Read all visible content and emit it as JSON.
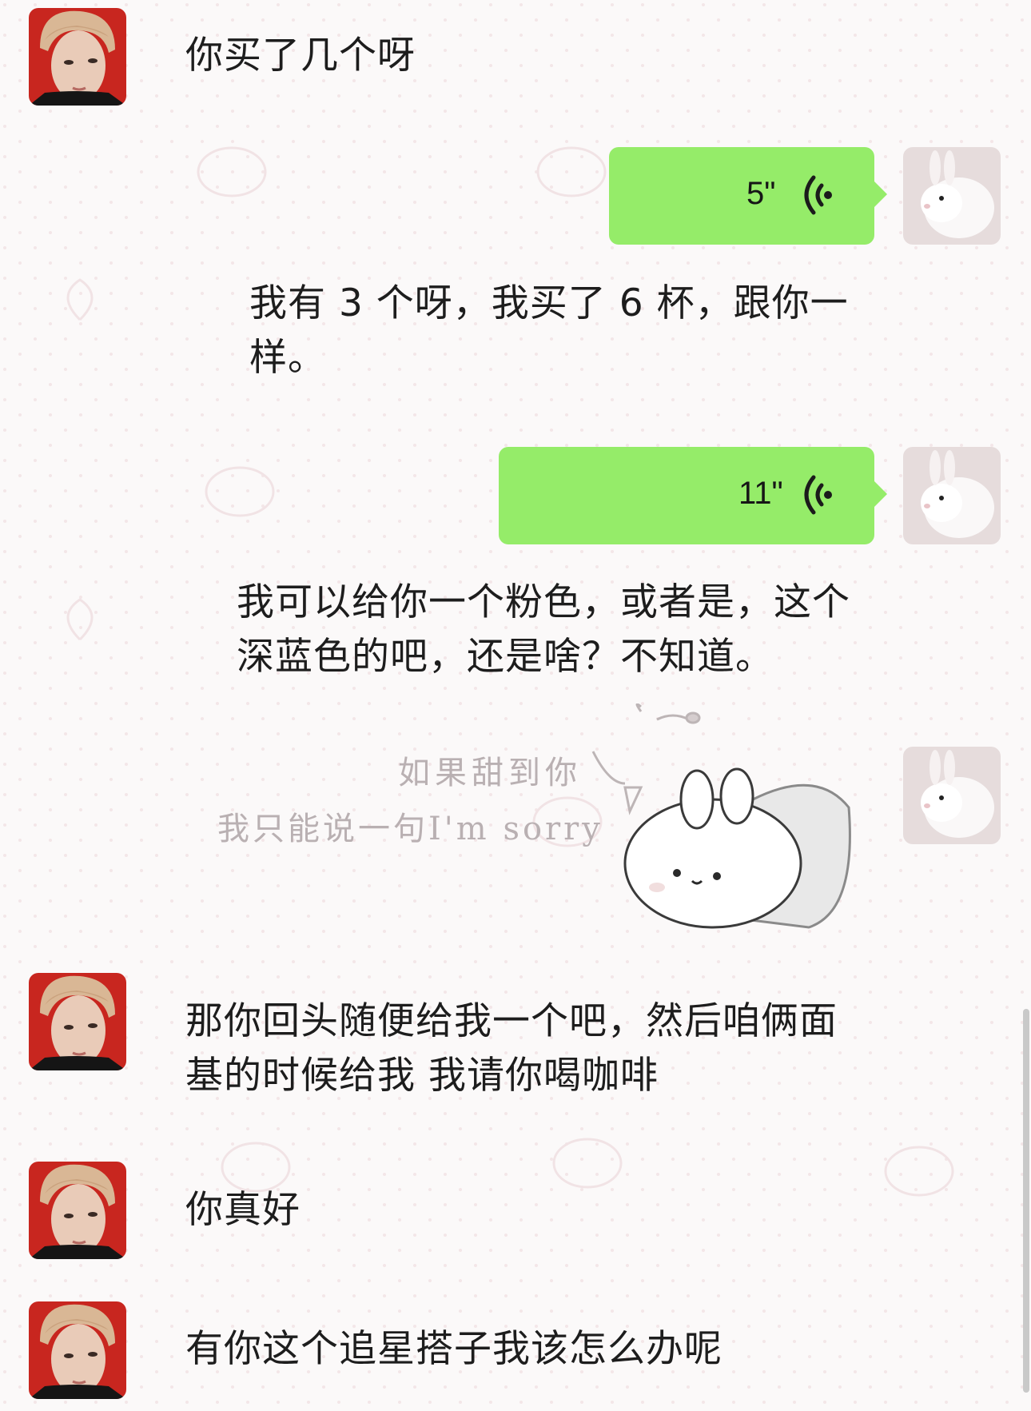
{
  "chat": {
    "messages": [
      {
        "side": "left",
        "type": "text",
        "text": "你买了几个呀"
      },
      {
        "side": "right",
        "type": "voice",
        "duration": "5\""
      },
      {
        "side": "right",
        "type": "transcription",
        "text": "我有 3 个呀，我买了 6 杯，跟你一样。"
      },
      {
        "side": "right",
        "type": "voice",
        "duration": "11\""
      },
      {
        "side": "right",
        "type": "transcription",
        "text": "我可以给你一个粉色，或者是，这个深蓝色的吧，还是啥？不知道。"
      },
      {
        "side": "right",
        "type": "sticker",
        "caption_line1": "如果甜到你",
        "caption_line2": "我只能说一句I'm sorry"
      },
      {
        "side": "left",
        "type": "text",
        "text": "那你回头随便给我一个吧，然后咱俩面基的时候给我 我请你喝咖啡"
      },
      {
        "side": "left",
        "type": "text",
        "text": "你真好"
      },
      {
        "side": "left",
        "type": "text",
        "text": "有你这个追星搭子我该怎么办呢"
      }
    ]
  },
  "colors": {
    "bubble_green": "#95ec69",
    "background": "#fbf9f9",
    "text": "#1d1d1d"
  },
  "icons": {
    "voice": "voice-wave-icon",
    "contact_avatar": "boy-photo",
    "self_avatar": "white-bunny-photo"
  }
}
